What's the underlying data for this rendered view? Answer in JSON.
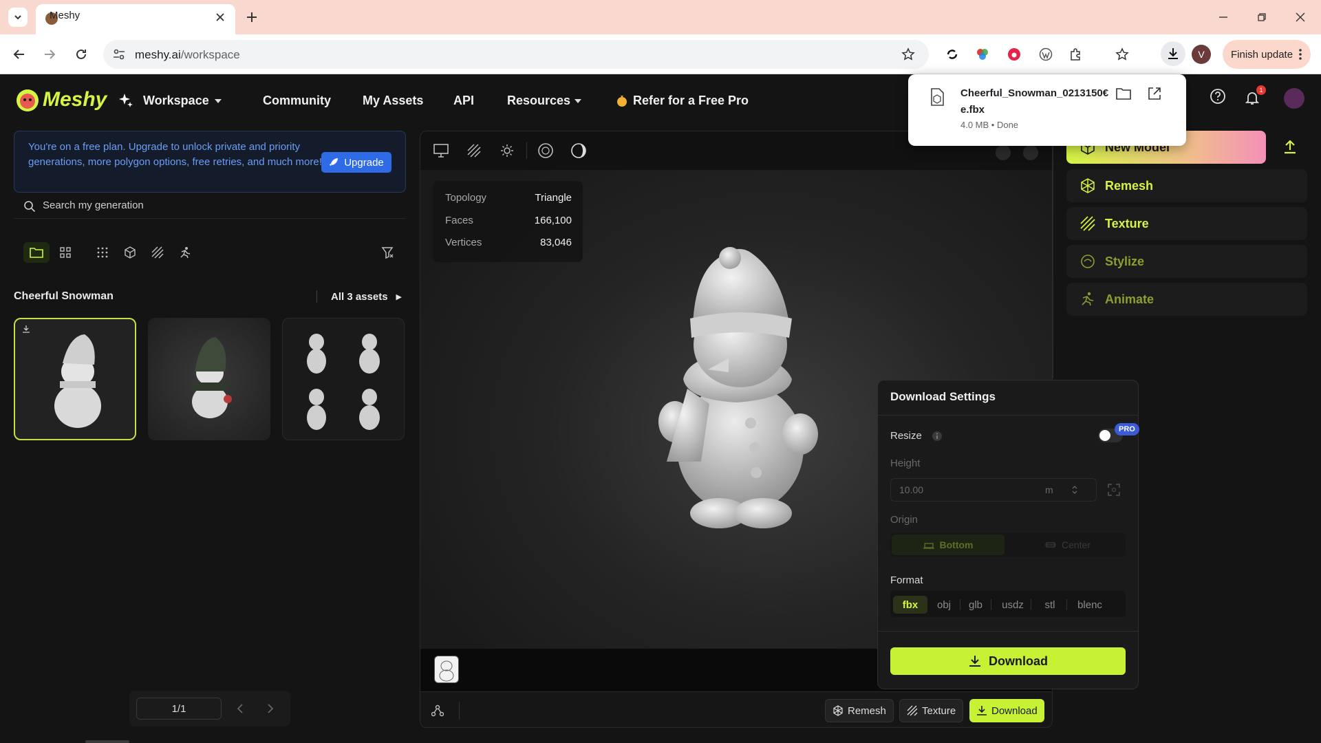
{
  "browser": {
    "tab_title": "Meshy",
    "url_host": "meshy.ai",
    "url_path": "/workspace",
    "finish_update": "Finish update",
    "profile_initial": "V"
  },
  "download_bubble": {
    "file_name": "Cheerful_Snowman_0213150€\ne.fbx",
    "file_name_line1": "Cheerful_Snowman_0213150€",
    "file_name_line2": "e.fbx",
    "meta": "4.0 MB • Done"
  },
  "header": {
    "logo": "Meshy",
    "nav": {
      "workspace": "Workspace",
      "community": "Community",
      "my_assets": "My Assets",
      "api": "API",
      "resources": "Resources",
      "refer": "Refer for a Free Pro"
    },
    "notification_count": "1"
  },
  "left": {
    "banner_text": "You're on a free plan. Upgrade to unlock private and priority generations, more polygon options, free retries, and much more!",
    "upgrade_label": "Upgrade",
    "search_placeholder": "Search my generation",
    "generation_title": "Cheerful Snowman",
    "all_assets": "All 3 assets",
    "pager": "1/1"
  },
  "viewport": {
    "stats": [
      {
        "key": "Topology",
        "value": "Triangle"
      },
      {
        "key": "Faces",
        "value": "166,100"
      },
      {
        "key": "Vertices",
        "value": "83,046"
      }
    ],
    "bottom_buttons": {
      "remesh": "Remesh",
      "texture": "Texture",
      "download": "Download"
    }
  },
  "right": {
    "new_model": "New Model",
    "remesh": "Remesh",
    "texture": "Texture",
    "stylize": "Stylize",
    "animate": "Animate"
  },
  "download_settings": {
    "title": "Download Settings",
    "resize_label": "Resize",
    "pro_badge": "PRO",
    "height_label": "Height",
    "height_value": "10.00",
    "height_unit": "m",
    "origin_label": "Origin",
    "origin_bottom": "Bottom",
    "origin_center": "Center",
    "format_label": "Format",
    "formats": [
      "fbx",
      "obj",
      "glb",
      "usdz",
      "stl",
      "blenc"
    ],
    "selected_format": "fbx",
    "download_label": "Download"
  },
  "colors": {
    "accent_lime": "#d4f542",
    "download_green": "#c6f135",
    "upgrade_blue": "#2f6be6",
    "pro_blue": "#3b5bd9"
  }
}
